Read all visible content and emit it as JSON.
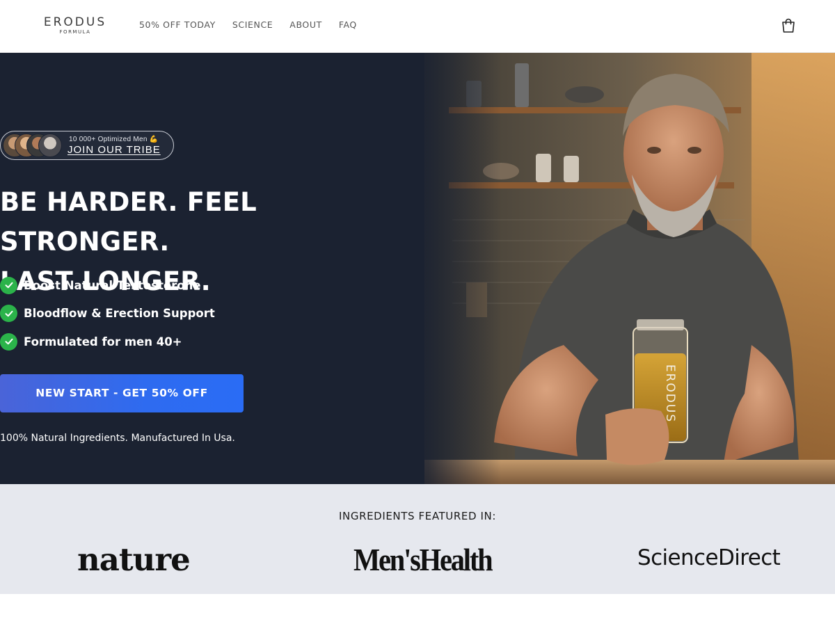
{
  "header": {
    "logo_main": "ERODUS",
    "logo_sub": "FORMULA",
    "nav": [
      "50% OFF TODAY",
      "SCIENCE",
      "ABOUT",
      "FAQ"
    ],
    "cart_icon": "shopping-bag-icon"
  },
  "hero": {
    "tribe_count": "10 000+ Optimized Men 💪",
    "tribe_join": "JOIN OUR TRIBE",
    "headline_line1": "BE HARDER. FEEL STRONGER.",
    "headline_line2": "LAST LONGER.",
    "benefits": [
      "Boost Natural Testosterone",
      "Bloodflow & Erection Support",
      "Formulated for men 40+"
    ],
    "cta_label": "NEW START - GET 50% OFF",
    "note": "100% Natural Ingredients. Manufactured In Usa.",
    "jar_label": "ERODUS",
    "colors": {
      "background": "#1b2231",
      "check": "#2bb34a",
      "cta": "#2e6bf0"
    }
  },
  "featured": {
    "title": "INGREDIENTS FEATURED IN:",
    "logos": [
      "nature",
      "Men'sHealth",
      "ScienceDirect"
    ]
  }
}
